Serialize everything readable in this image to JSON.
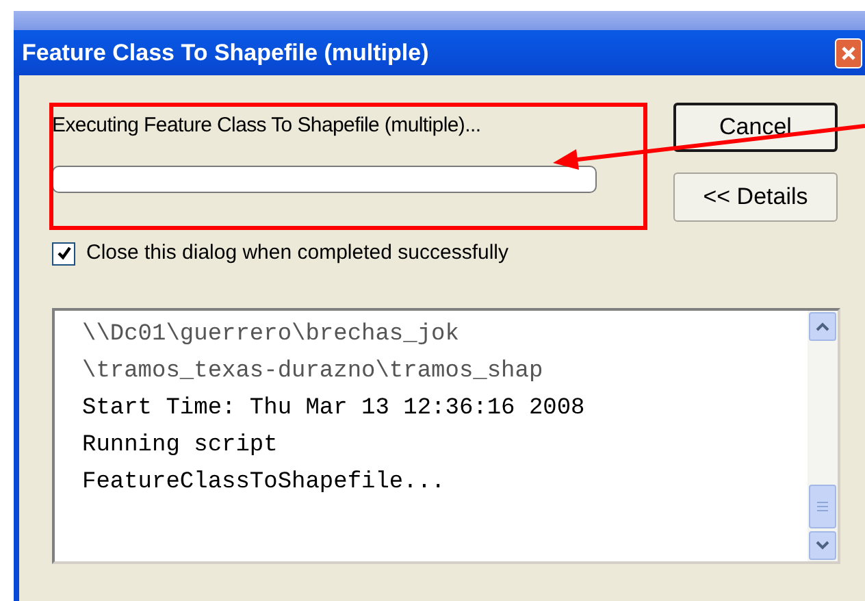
{
  "window": {
    "title": "Feature Class To Shapefile (multiple)"
  },
  "status_text": "Executing Feature Class To Shapefile (multiple)...",
  "progress": {
    "level": 0
  },
  "buttons": [
    {
      "label": "Cancel",
      "kind": "default"
    },
    {
      "label": "<< Details",
      "kind": "normal"
    }
  ],
  "close_checkbox": {
    "label": "Close this dialog when completed successfully",
    "checked": true
  },
  "log_lines": [
    {
      "text": "\\\\Dc01\\guerrero\\brechas_jok",
      "kind": "path"
    },
    {
      "text": "\\tramos_texas-durazno\\tramos_shap",
      "kind": "path"
    },
    {
      "text": "Start Time: Thu Mar 13 12:36:16 2008",
      "kind": "message"
    },
    {
      "text": "Running script",
      "kind": "message"
    },
    {
      "text": "FeatureClassToShapefile...",
      "kind": "message"
    }
  ]
}
